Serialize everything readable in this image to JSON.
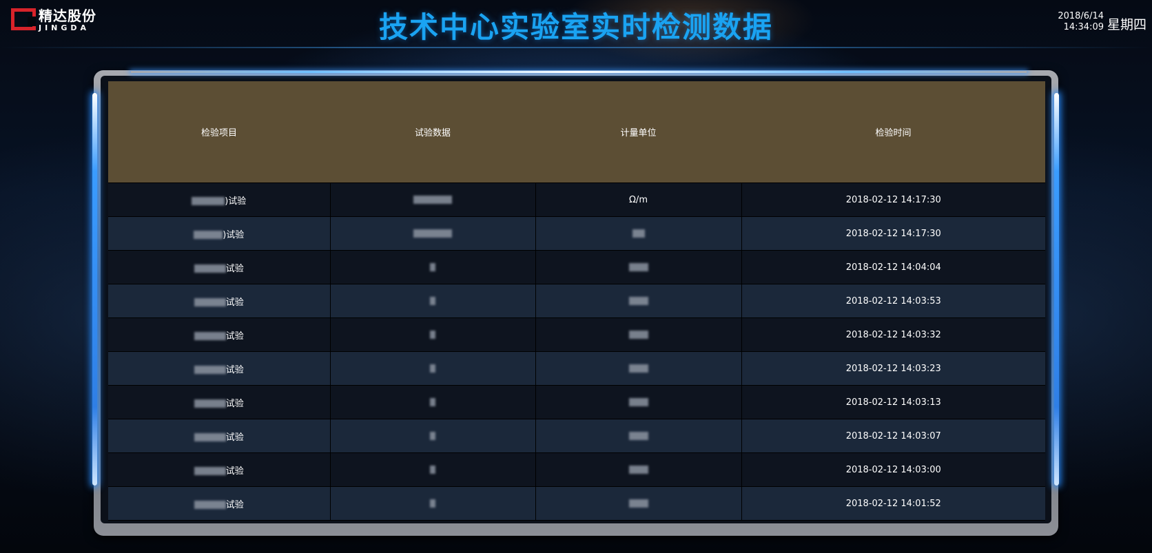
{
  "header": {
    "logo_cn": "精达股份",
    "logo_en": "JINGDA",
    "title": "技术中心实验室实时检测数据",
    "date": "2018/6/14",
    "time": "14:34:09",
    "weekday": "星期四"
  },
  "table": {
    "columns": [
      "检验项目",
      "试验数据",
      "计量单位",
      "检验时间"
    ],
    "rows": [
      {
        "item_suffix": ")试验",
        "unit": "Ω/m",
        "time": "2018-02-12 14:17:30"
      },
      {
        "item_suffix": ")试验",
        "unit": "",
        "time": "2018-02-12 14:17:30"
      },
      {
        "item_suffix": "试验",
        "unit": "",
        "time": "2018-02-12 14:04:04"
      },
      {
        "item_suffix": "试验",
        "unit": "",
        "time": "2018-02-12 14:03:53"
      },
      {
        "item_suffix": "试验",
        "unit": "",
        "time": "2018-02-12 14:03:32"
      },
      {
        "item_suffix": "试验",
        "unit": "",
        "time": "2018-02-12 14:03:23"
      },
      {
        "item_suffix": "试验",
        "unit": "",
        "time": "2018-02-12 14:03:13"
      },
      {
        "item_suffix": "试验",
        "unit": "",
        "time": "2018-02-12 14:03:07"
      },
      {
        "item_suffix": "试验",
        "unit": "",
        "time": "2018-02-12 14:03:00"
      },
      {
        "item_suffix": "试验",
        "unit": "",
        "time": "2018-02-12 14:01:52"
      }
    ]
  }
}
